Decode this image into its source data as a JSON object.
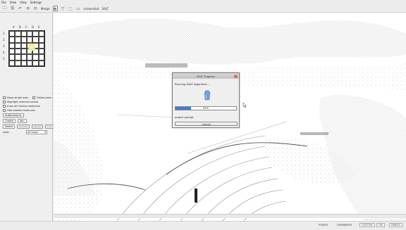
{
  "menu": [
    "File",
    "View",
    "View",
    "Settings"
  ],
  "toolbar": {
    "merge_label": "Merge",
    "screenshot_label": "screenshot",
    "salt_label": "SALT"
  },
  "grid": {
    "columns": [
      "A",
      "B",
      "C",
      "D",
      "E"
    ],
    "rows": [
      "1",
      "2",
      "3",
      "4",
      "5"
    ]
  },
  "controls": {
    "show_single_scan": "Show single scan",
    "follow_pose": "Follow pose",
    "highlight_instance_points": "Highlight instance points",
    "show_all_moving_instances": "show all moving instances",
    "hide_labeled_instances": "hide labeled instances",
    "autoinstance_label": "AutoInstance",
    "create_label": "Create",
    "join_label": "Join",
    "select_label": "Select",
    "delete_label": "Delete",
    "apply_label": "Apply",
    "clear_label": "Clear",
    "loop_label": "Loop",
    "loop_value": "all loops"
  },
  "bottom_tabs": [
    "Visuals",
    "Points",
    "Instances"
  ],
  "dialog": {
    "title": "SALT Progress",
    "message": "Running SALT Algorithm...",
    "progress": 25,
    "progress_text": "25%",
    "sub_message": "project prompt",
    "cancel_label": "Cancel"
  },
  "status": {
    "points": "POINTS",
    "overwrite": "OVERWRITE",
    "custom": "CUSTOM",
    "on": "ON",
    "extra": "DEBUG"
  },
  "colors": {
    "progress_fill": "#3f7fd0",
    "dialog_close": "#e25c2c",
    "cup_icon": "#5b8fd6"
  }
}
